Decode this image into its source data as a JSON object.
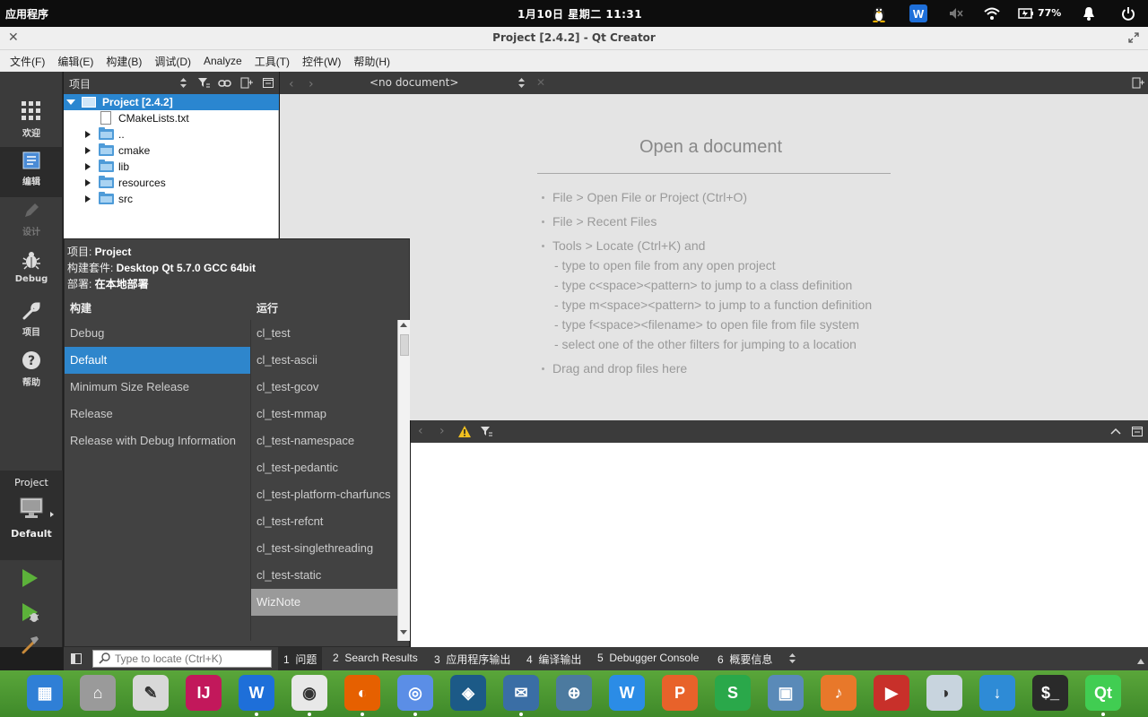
{
  "topbar": {
    "apps_label": "应用程序",
    "clock": "1月10日 星期二   11:31",
    "battery": "77%",
    "tray_icons": [
      "tux-icon",
      "wiznote-tray-icon",
      "mute-icon",
      "wifi-icon",
      "battery-icon",
      "bell-icon",
      "power-icon"
    ]
  },
  "window": {
    "title": "Project [2.4.2] - Qt Creator"
  },
  "menubar": [
    "文件(F)",
    "编辑(E)",
    "构建(B)",
    "调试(D)",
    "Analyze",
    "工具(T)",
    "控件(W)",
    "帮助(H)"
  ],
  "modes": [
    {
      "label": "欢迎",
      "icon": "grid-icon"
    },
    {
      "label": "编辑",
      "icon": "edit-doc-icon"
    },
    {
      "label": "设计",
      "icon": "pencil-icon"
    },
    {
      "label": "Debug",
      "icon": "bug-icon"
    },
    {
      "label": "项目",
      "icon": "wrench-icon"
    },
    {
      "label": "帮助",
      "icon": "help-icon"
    }
  ],
  "target": {
    "project": "Project",
    "config": "Default"
  },
  "tree": {
    "header": "项目",
    "root": "Project [2.4.2]",
    "items": [
      "CMakeLists.txt",
      "..",
      "cmake",
      "lib",
      "resources",
      "src"
    ]
  },
  "editor": {
    "doc_label": "<no document>",
    "open_title": "Open a document",
    "hints": [
      "File > Open File or Project (Ctrl+O)",
      "File > Recent Files",
      "Tools > Locate (Ctrl+K) and",
      "- type to open file from any open project",
      "- type c<space><pattern> to jump to a class definition",
      "- type m<space><pattern> to jump to a function definition",
      "- type f<space><filename> to open file from file system",
      "- select one of the other filters for jumping to a location",
      "Drag and drop files here"
    ]
  },
  "popup": {
    "project_label": "项目: ",
    "project_value": "Project",
    "kit_label": "构建套件: ",
    "kit_value": "Desktop Qt 5.7.0 GCC 64bit",
    "deploy_label": "部署: ",
    "deploy_value": "在本地部署",
    "build_header": "构建",
    "run_header": "运行",
    "builds": [
      "Debug",
      "Default",
      "Minimum Size Release",
      "Release",
      "Release with Debug Information"
    ],
    "selected_build": 1,
    "runs": [
      "cl_test",
      "cl_test-ascii",
      "cl_test-gcov",
      "cl_test-mmap",
      "cl_test-namespace",
      "cl_test-pedantic",
      "cl_test-platform-charfuncs",
      "cl_test-refcnt",
      "cl_test-singlethreading",
      "cl_test-static",
      "WizNote"
    ],
    "selected_run": 10
  },
  "statusbar": {
    "locate_placeholder": "Type to locate (Ctrl+K)",
    "tabs": [
      {
        "num": "1",
        "label": "问题"
      },
      {
        "num": "2",
        "label": "Search Results"
      },
      {
        "num": "3",
        "label": "应用程序输出"
      },
      {
        "num": "4",
        "label": "编译输出"
      },
      {
        "num": "5",
        "label": "Debugger Console"
      },
      {
        "num": "6",
        "label": "概要信息"
      }
    ]
  },
  "dock": [
    {
      "name": "workspace",
      "color": "#2f7fd6",
      "glyph": "▦"
    },
    {
      "name": "home-folder",
      "color": "#9a9a9a",
      "glyph": "⌂"
    },
    {
      "name": "text-editor",
      "color": "#d8d8d8",
      "glyph": "✎"
    },
    {
      "name": "intellij",
      "color": "#c2185b",
      "glyph": "IJ"
    },
    {
      "name": "wiznote",
      "color": "#1e6fd9",
      "glyph": "W"
    },
    {
      "name": "chrome",
      "color": "#e8e8e8",
      "glyph": "◉"
    },
    {
      "name": "firefox",
      "color": "#e66000",
      "glyph": "◐"
    },
    {
      "name": "chromium",
      "color": "#5b8ee6",
      "glyph": "◎"
    },
    {
      "name": "mysql-workbench",
      "color": "#1c5a87",
      "glyph": "◈"
    },
    {
      "name": "thunderbird",
      "color": "#3a6ea5",
      "glyph": "✉"
    },
    {
      "name": "network",
      "color": "#4c7a9f",
      "glyph": "⊕"
    },
    {
      "name": "wps-writer",
      "color": "#2b8ce6",
      "glyph": "W"
    },
    {
      "name": "wps-presentation",
      "color": "#e8622a",
      "glyph": "P"
    },
    {
      "name": "wps-spreadsheet",
      "color": "#2aa84a",
      "glyph": "S"
    },
    {
      "name": "image-viewer",
      "color": "#5a8ab8",
      "glyph": "▣"
    },
    {
      "name": "music",
      "color": "#e8782a",
      "glyph": "♪"
    },
    {
      "name": "video",
      "color": "#c8302a",
      "glyph": "▶"
    },
    {
      "name": "settings-toggle",
      "color": "#c8d4de",
      "glyph": "◑"
    },
    {
      "name": "download",
      "color": "#2e8bd6",
      "glyph": "↓"
    },
    {
      "name": "terminal",
      "color": "#2a2a2a",
      "glyph": "$_"
    },
    {
      "name": "qt-creator",
      "color": "#41cd52",
      "glyph": "Qt"
    }
  ]
}
